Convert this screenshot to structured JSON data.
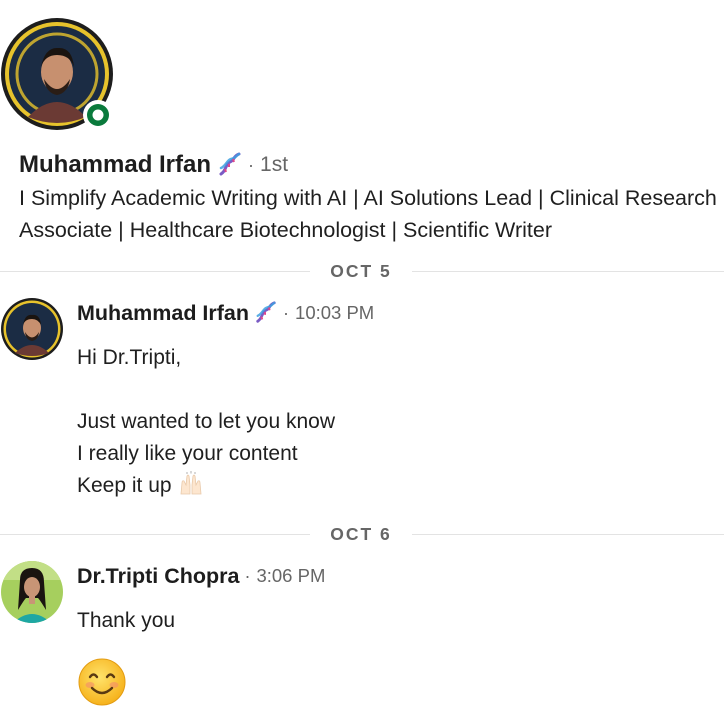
{
  "profile": {
    "name": "Muhammad Irfan",
    "degree": "1st",
    "headline": "I Simplify Academic Writing with AI | AI Solutions Lead | Clinical Research Associate | Healthcare Biotechnologist | Scientific Writer",
    "online_status": "online",
    "badge_icon": "dna-icon"
  },
  "conversation": {
    "dividers": [
      "OCT 5",
      "OCT 6"
    ],
    "messages": [
      {
        "sender": "Muhammad Irfan",
        "time": "10:03 PM",
        "lines": [
          "Hi Dr.Tripti,",
          "",
          "Just wanted to let you know",
          "I really like your content",
          "Keep it up"
        ],
        "trailing_emoji": "raising-hands-emoji"
      },
      {
        "sender": "Dr.Tripti Chopra",
        "time": "3:06 PM",
        "lines": [
          "Thank you"
        ],
        "trailing_emoji": "smiling-face-emoji"
      }
    ]
  },
  "separator": "·",
  "colors": {
    "online_ring": "#0a7a3c",
    "avatar_ring": "#e7c32c",
    "divider_text": "#666666"
  }
}
